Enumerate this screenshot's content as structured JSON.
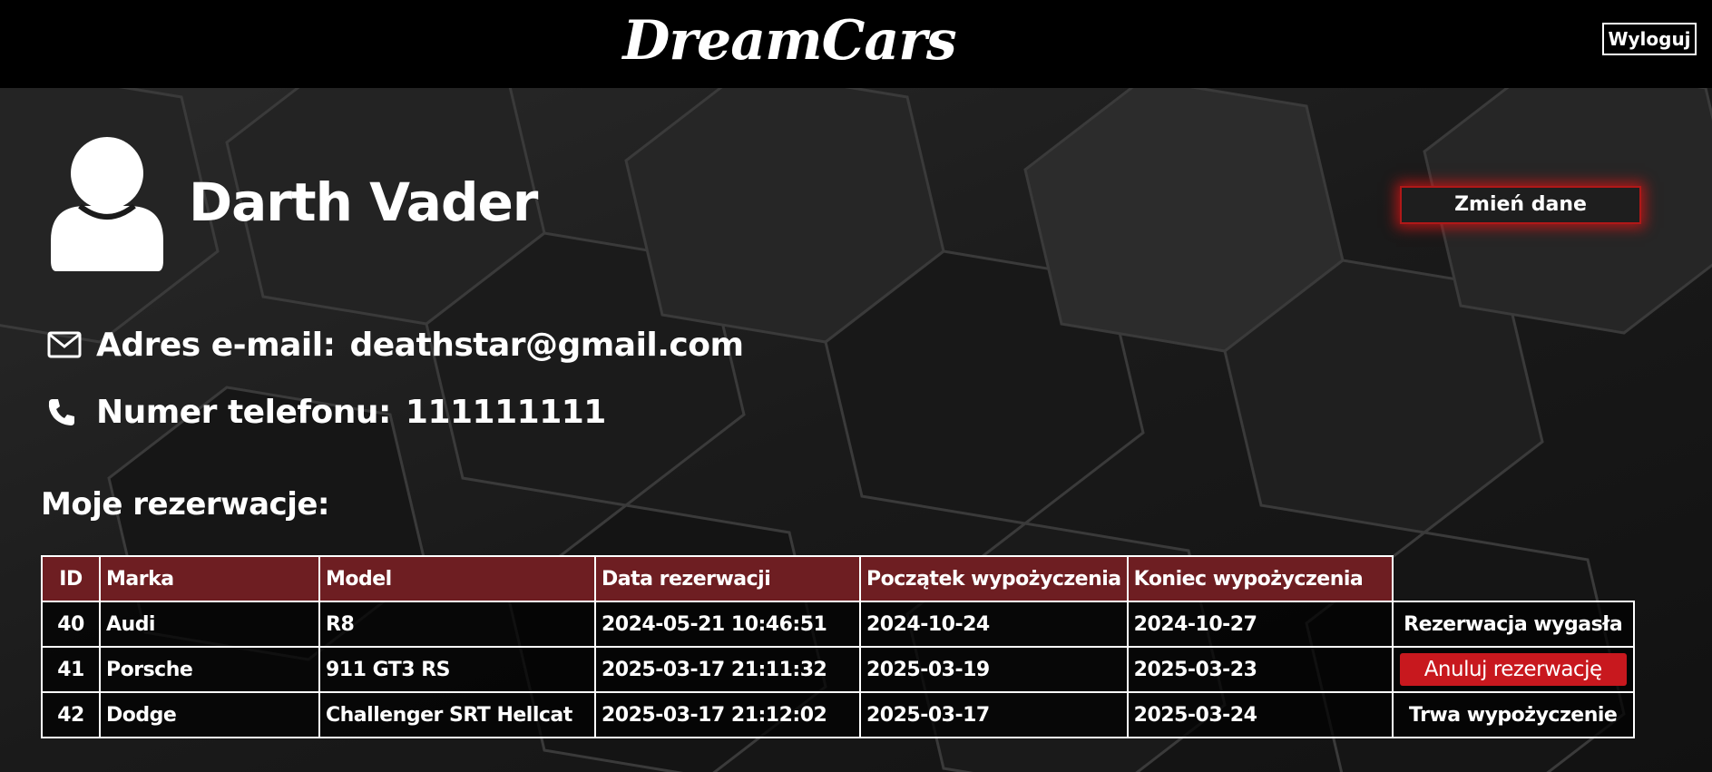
{
  "header": {
    "logo_text": "DreamCars",
    "logout_label": "Wyloguj"
  },
  "profile": {
    "name": "Darth Vader",
    "edit_label": "Zmień dane",
    "avatar_icon": "user-avatar-icon",
    "email_label": "Adres e-mail:",
    "email_value": "deathstar@gmail.com",
    "email_icon": "envelope-icon",
    "phone_label": "Numer telefonu:",
    "phone_value": "111111111",
    "phone_icon": "phone-icon"
  },
  "reservations": {
    "title": "Moje rezerwacje:",
    "columns": [
      "ID",
      "Marka",
      "Model",
      "Data rezerwacji",
      "Początek wypożyczenia",
      "Koniec wypożyczenia"
    ],
    "rows": [
      {
        "id": "40",
        "brand": "Audi",
        "model": "R8",
        "reserved_at": "2024-05-21 10:46:51",
        "start": "2024-10-24",
        "end": "2024-10-27",
        "status": "Rezerwacja wygasła"
      },
      {
        "id": "41",
        "brand": "Porsche",
        "model": "911 GT3 RS",
        "reserved_at": "2025-03-17 21:11:32",
        "start": "2025-03-19",
        "end": "2025-03-23",
        "status": "Anuluj rezerwację"
      },
      {
        "id": "42",
        "brand": "Dodge",
        "model": "Challenger SRT Hellcat",
        "reserved_at": "2025-03-17 21:12:02",
        "start": "2025-03-17",
        "end": "2025-03-24",
        "status": "Trwa wypożyczenie"
      }
    ]
  },
  "colors": {
    "header_bg": "#000000",
    "accent_red": "#c8181e",
    "table_header_bg": "#6e1e22"
  }
}
